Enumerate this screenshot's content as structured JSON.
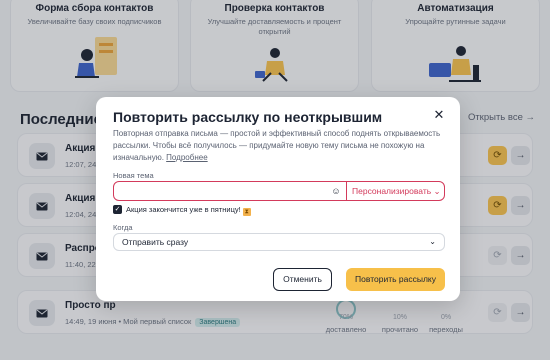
{
  "feature_cards": [
    {
      "title": "Форма сбора контактов",
      "subtitle": "Увеличивайте базу своих подписчиков"
    },
    {
      "title": "Проверка контактов",
      "subtitle": "Улучшайте доставляемость и процент открытий"
    },
    {
      "title": "Автоматизация",
      "subtitle": "Упрощайте рутинные задачи"
    }
  ],
  "campaigns": {
    "title": "Последние ра",
    "open_all": "Открыть все →",
    "rows": [
      {
        "name": "Акция за",
        "meta": "12:07, 24 и"
      },
      {
        "name": "Акция за",
        "meta": "12:04, 24 и"
      },
      {
        "name": "Распрода",
        "meta": "11:40, 22 и"
      },
      {
        "name": "Просто пр",
        "meta": "14:49, 19 июня • Мой первый список",
        "status": "Завершена",
        "stats": [
          "70%",
          "10%",
          "0%"
        ],
        "stat_labels": [
          "доставлено",
          "прочитано",
          "переходы"
        ]
      }
    ]
  },
  "modal": {
    "title": "Повторить рассылку по неоткрывшим",
    "description": "Повторная отправка письма — простой и эффективный способ поднять открываемость рассылки. Чтобы всё получилось — придумайте новую тему письма не похожую на изначальную.",
    "more_link": "Подробнее",
    "subject_label": "Новая тема",
    "subject_value": "",
    "personalize_label": "Персонализировать",
    "checkbox_label": "Акция закончится уже в пятницу!",
    "checkbox_checked": true,
    "when_label": "Когда",
    "when_value": "Отправить сразу",
    "cancel_label": "Отменить",
    "submit_label": "Повторить рассылку"
  },
  "colors": {
    "accent": "#f7c04a",
    "error": "#d33a5b",
    "dark": "#1d2433"
  }
}
